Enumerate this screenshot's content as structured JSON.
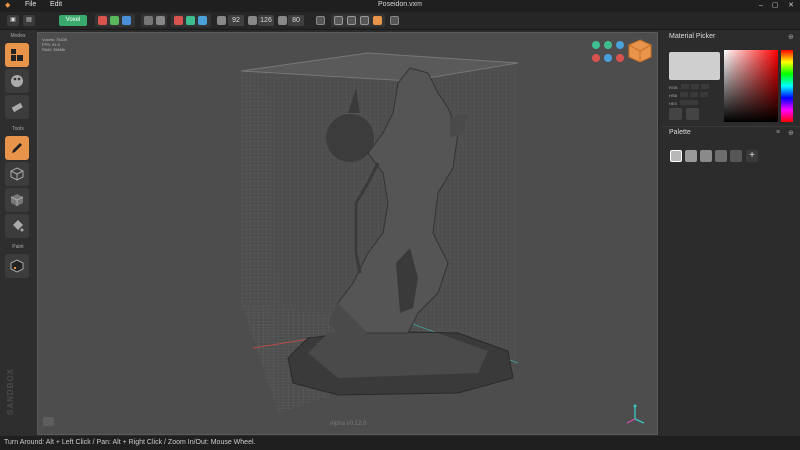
{
  "app": {
    "title": "Poseidon.vxm"
  },
  "menu": {
    "file": "File",
    "edit": "Edit"
  },
  "toolbar": {
    "mode_button": "Voxel",
    "count_x": "92",
    "count_y": "126",
    "count_z": "80"
  },
  "left_panel": {
    "modes_label": "Modes",
    "tools_label": "Tools",
    "paint_label": "Paint",
    "brand": "SANDBOX"
  },
  "viewport": {
    "stats": [
      "Voxels: 75439",
      "FPS: 91.0",
      "RAM: 356Mb"
    ],
    "version": "Alpha v0.12.0"
  },
  "material_picker": {
    "title": "Material Picker",
    "rgb_label": "RGB",
    "hsb_label": "HSB",
    "hex_label": "HEX"
  },
  "palette": {
    "title": "Palette",
    "add_label": "+"
  },
  "colors": {
    "accent": "#e8944a",
    "green": "#3aaa6c",
    "swatch_current": "#cfcfcf",
    "palette_swatches": [
      "#b8b8b8",
      "#9a9a9a",
      "#8a8a8a",
      "#6e6e6e",
      "#555555"
    ]
  },
  "status": {
    "help": "Turn Around: Alt + Left Click / Pan: Alt + Right Click / Zoom In/Out: Mouse Wheel."
  }
}
